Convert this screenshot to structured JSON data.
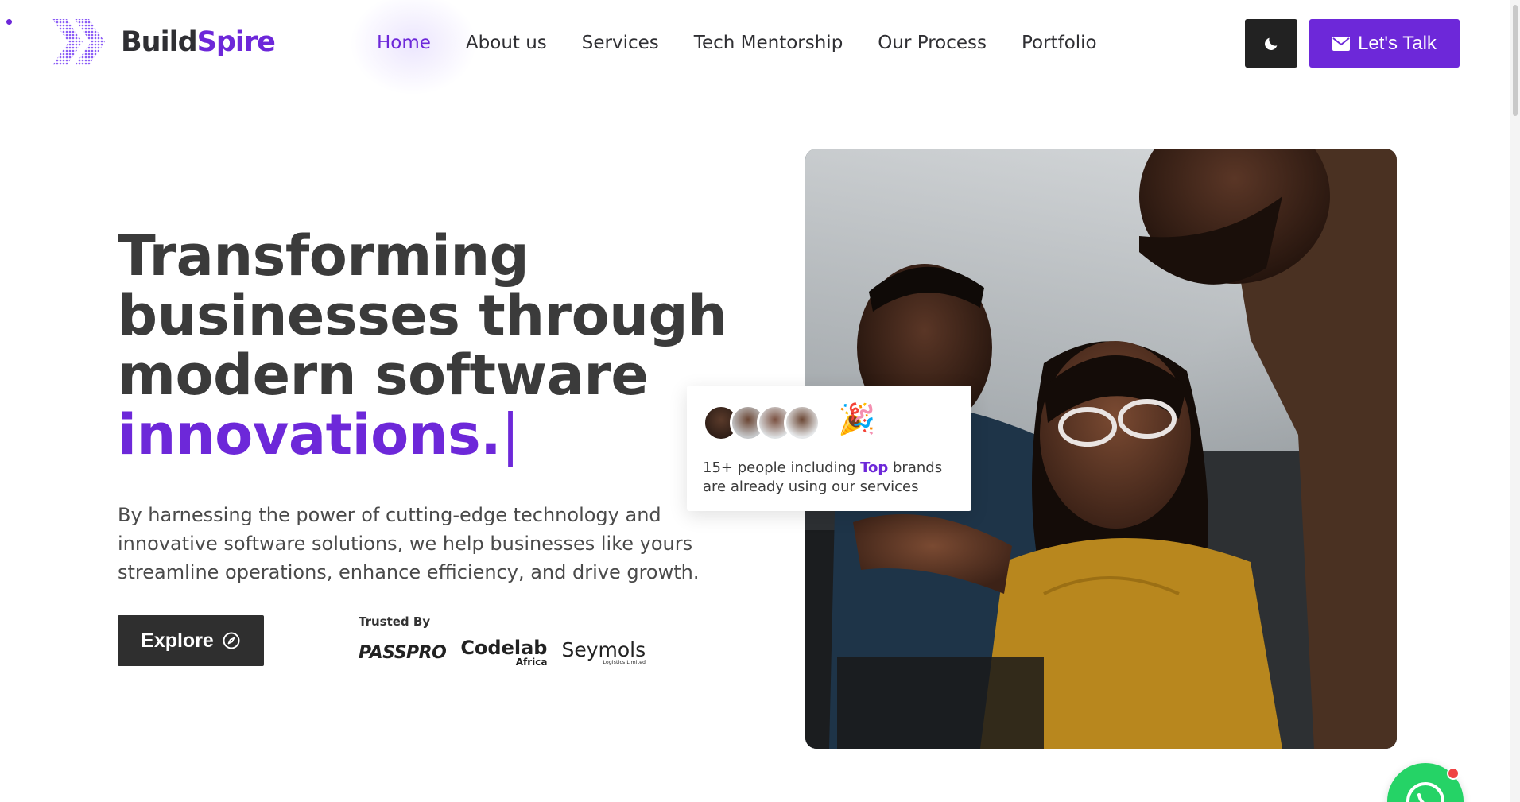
{
  "brand": {
    "name_part1": "Build",
    "name_part2": "Spire",
    "accent_color": "#6d28d9"
  },
  "nav": {
    "items": [
      {
        "label": "Home",
        "active": true
      },
      {
        "label": "About us",
        "active": false
      },
      {
        "label": "Services",
        "active": false
      },
      {
        "label": "Tech Mentorship",
        "active": false
      },
      {
        "label": "Our Process",
        "active": false
      },
      {
        "label": "Portfolio",
        "active": false
      }
    ]
  },
  "header_actions": {
    "theme_toggle_icon": "moon-icon",
    "cta_label": "Let's Talk",
    "cta_icon": "envelope-icon"
  },
  "hero": {
    "title_line1": "Transforming",
    "title_line2": "businesses through",
    "title_line3": "modern software",
    "title_accent": "innovations.",
    "cursor": "|",
    "description": "By harnessing the power of cutting-edge technology and innovative software solutions, we help businesses like yours streamline operations, enhance efficiency, and drive growth.",
    "explore_label": "Explore",
    "explore_icon": "compass-icon"
  },
  "trusted": {
    "label": "Trusted By",
    "logos": [
      {
        "name": "PASSPRO"
      },
      {
        "name": "Codelab",
        "sub": "Africa"
      },
      {
        "name": "Seymols",
        "sub": "Logistics Limited"
      }
    ]
  },
  "social_proof": {
    "text_before": "15+ people including ",
    "text_accent": "Top",
    "text_after": " brands are already using our services",
    "icon": "party-popper-icon"
  },
  "floating": {
    "whatsapp_icon": "whatsapp-icon"
  }
}
